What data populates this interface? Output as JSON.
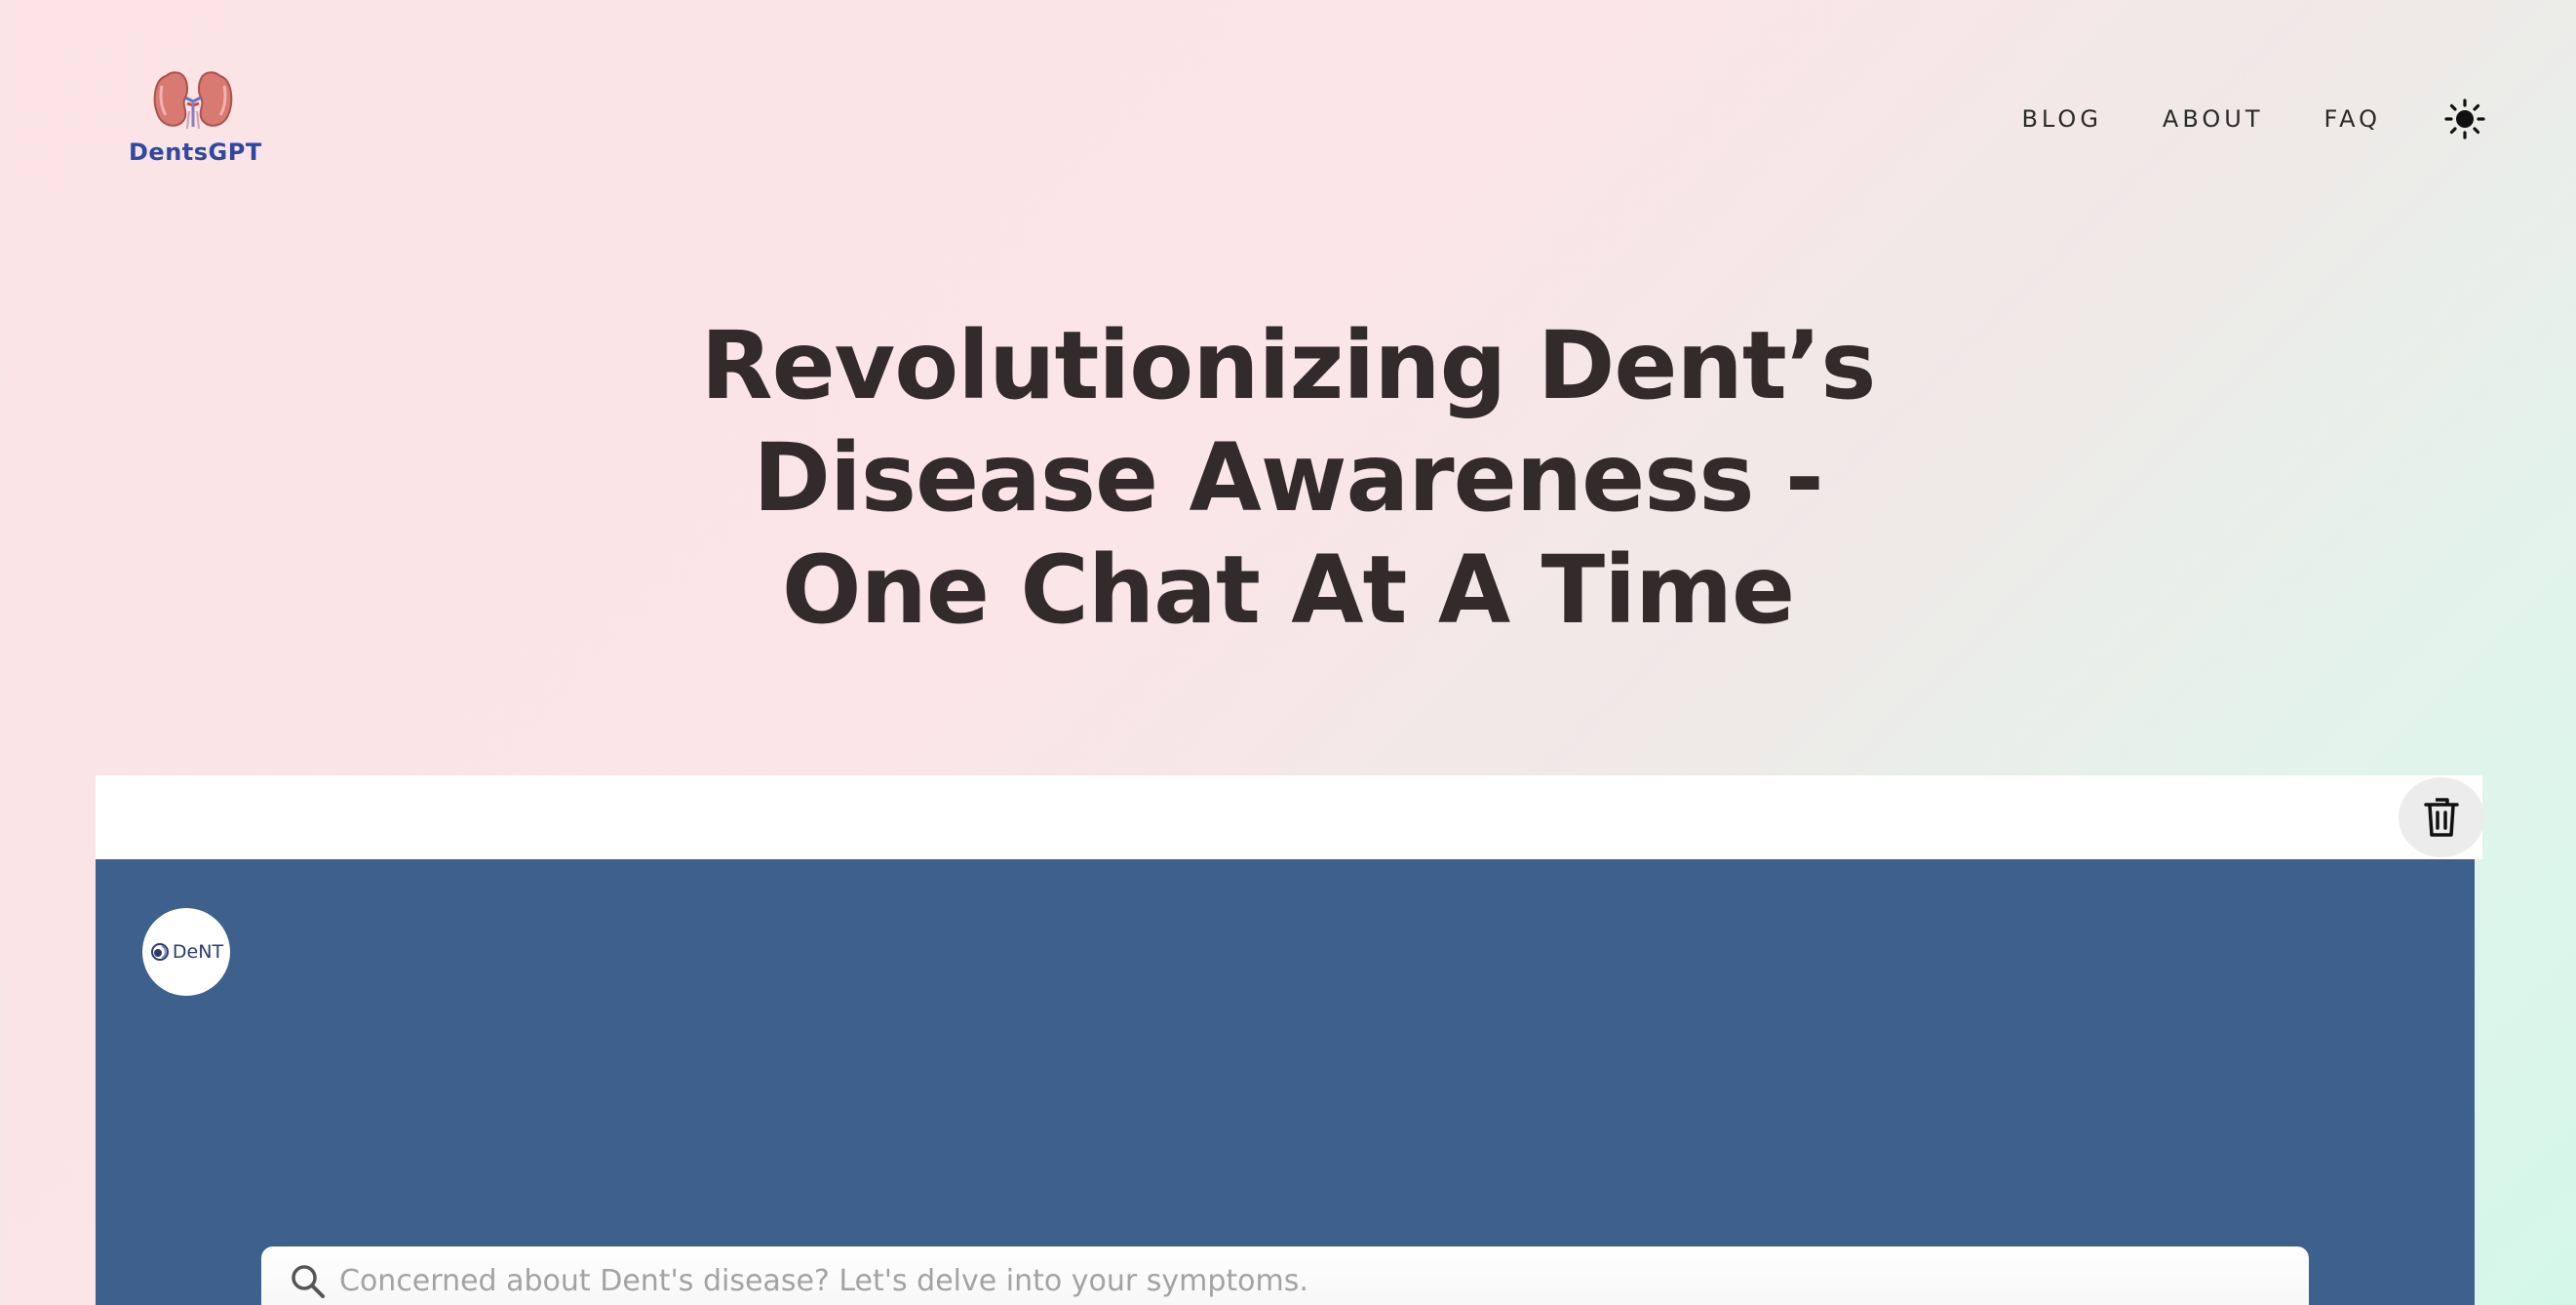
{
  "brand": {
    "name": "DentsGPT",
    "logo_icon": "kidneys-icon",
    "color": "#2f49a0"
  },
  "nav": {
    "items": [
      {
        "label": "BLOG"
      },
      {
        "label": "ABOUT"
      },
      {
        "label": "FAQ"
      }
    ],
    "theme_toggle_icon": "sun-icon"
  },
  "hero": {
    "line1": "Revolutionizing Dent’s",
    "line2": "Disease Awareness -",
    "line3": "One Chat At A Time"
  },
  "chat": {
    "clear_icon": "trash-icon",
    "bot_avatar_text": "DeNT",
    "panel_color": "#3d618c",
    "search": {
      "icon": "search-icon",
      "placeholder": "Concerned about Dent's disease? Let's delve into your symptoms.",
      "value": ""
    }
  }
}
